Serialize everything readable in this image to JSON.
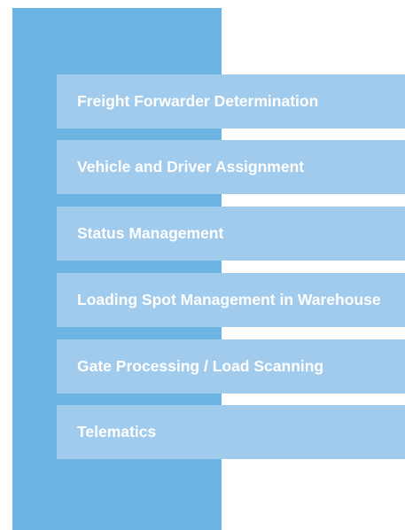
{
  "items": [
    {
      "label": "Freight Forwarder Determination"
    },
    {
      "label": "Vehicle and Driver Assignment"
    },
    {
      "label": "Status Management"
    },
    {
      "label": "Loading Spot Management in Warehouse"
    },
    {
      "label": "Gate Processing / Load Scanning"
    },
    {
      "label": "Telematics"
    }
  ],
  "colors": {
    "panel": "#6cb4e2",
    "item": "#a0cbec",
    "text": "#ffffff"
  }
}
